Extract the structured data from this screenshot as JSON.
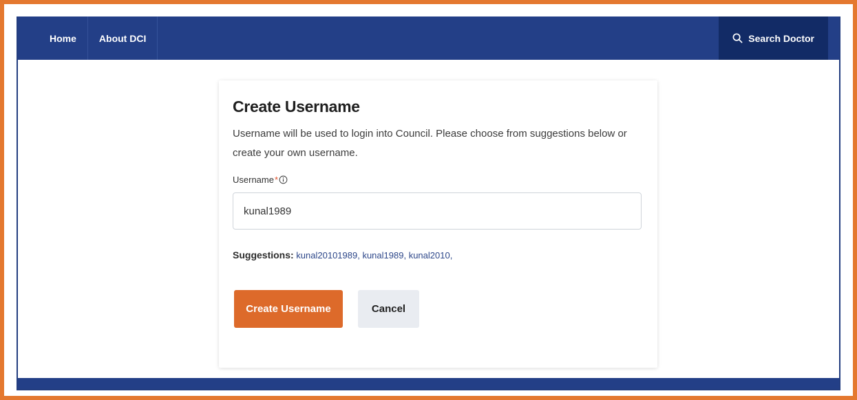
{
  "nav": {
    "home": "Home",
    "about": "About DCI",
    "search_doctor": "Search Doctor"
  },
  "form": {
    "title": "Create Username",
    "description": "Username will be used to login into Council. Please choose from suggestions below or create your own username.",
    "username_label": "Username",
    "required_mark": "*",
    "username_value": "kunal1989",
    "suggestions_label": "Suggestions:",
    "suggestions": [
      "kunal20101989,",
      "kunal1989,",
      "kunal2010,"
    ],
    "create_button": "Create Username",
    "cancel_button": "Cancel"
  },
  "colors": {
    "frame_border": "#e4782f",
    "nav_bg": "#233f87",
    "search_bg": "#122b66",
    "primary_button": "#dd6a2a",
    "secondary_button": "#e9ecf1",
    "link": "#2c4689",
    "required": "#e0522c"
  },
  "icons": {
    "search": "search-icon",
    "info": "info-icon"
  }
}
